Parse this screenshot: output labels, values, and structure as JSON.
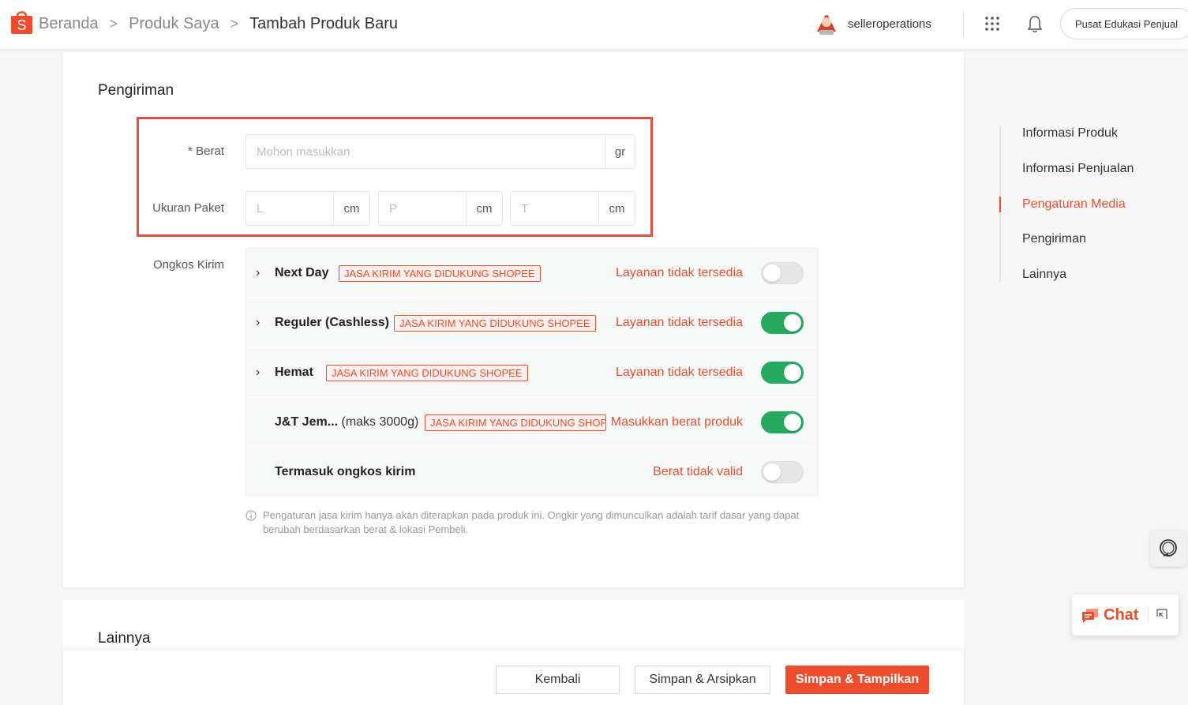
{
  "header": {
    "breadcrumb": [
      "Beranda",
      "Produk Saya",
      "Tambah Produk Baru"
    ],
    "breadcrumb_separator": ">",
    "username": "selleroperations",
    "edu_button": "Pusat Edukasi Penjual"
  },
  "shipping": {
    "section_title": "Pengiriman",
    "weight_label": "* Berat",
    "weight_placeholder": "Mohon masukkan",
    "weight_unit": "gr",
    "package_label": "Ukuran Paket",
    "dims": [
      {
        "placeholder": "L",
        "unit": "cm"
      },
      {
        "placeholder": "P",
        "unit": "cm"
      },
      {
        "placeholder": "T",
        "unit": "cm"
      }
    ],
    "cost_label": "Ongkos Kirim",
    "rows": [
      {
        "name": "Next Day",
        "sub": "",
        "tag": "JASA KIRIM YANG DIDUKUNG SHOPEE",
        "status": "Layanan tidak tersedia",
        "enabled": false,
        "expandable": true
      },
      {
        "name": "Reguler (Cashless)",
        "sub": "",
        "tag": "JASA KIRIM YANG DIDUKUNG SHOPEE",
        "status": "Layanan tidak tersedia",
        "enabled": true,
        "expandable": true
      },
      {
        "name": "Hemat",
        "sub": "",
        "tag": "JASA KIRIM YANG DIDUKUNG SHOPEE",
        "status": "Layanan tidak tersedia",
        "enabled": true,
        "expandable": true
      },
      {
        "name": "J&T Jem...",
        "sub": "(maks 3000g)",
        "tag": "JASA KIRIM YANG DIDUKUNG SHOPEE",
        "status": "Masukkan berat produk",
        "enabled": true,
        "expandable": false
      },
      {
        "name": "Termasuk ongkos kirim",
        "sub": "",
        "tag": "",
        "status": "Berat tidak valid",
        "enabled": false,
        "expandable": false
      }
    ],
    "note": "Pengaturan jasa kirim hanya akan diterapkan pada produk ini. Ongkir yang dimunculkan adalah tarif dasar yang dapat berubah berdasarkan berat & lokasi Pembeli."
  },
  "other_section_title": "Lainnya",
  "footer": {
    "back": "Kembali",
    "save_archive": "Simpan & Arsipkan",
    "save_show": "Simpan & Tampilkan"
  },
  "side_nav": {
    "items": [
      "Informasi Produk",
      "Informasi Penjualan",
      "Pengaturan Media",
      "Pengiriman",
      "Lainnya"
    ],
    "active_index": 2
  },
  "chat": {
    "label": "Chat"
  },
  "colors": {
    "brand": "#ee4d2d",
    "toggle_on": "#26aa60",
    "highlight": "#e0513f"
  }
}
